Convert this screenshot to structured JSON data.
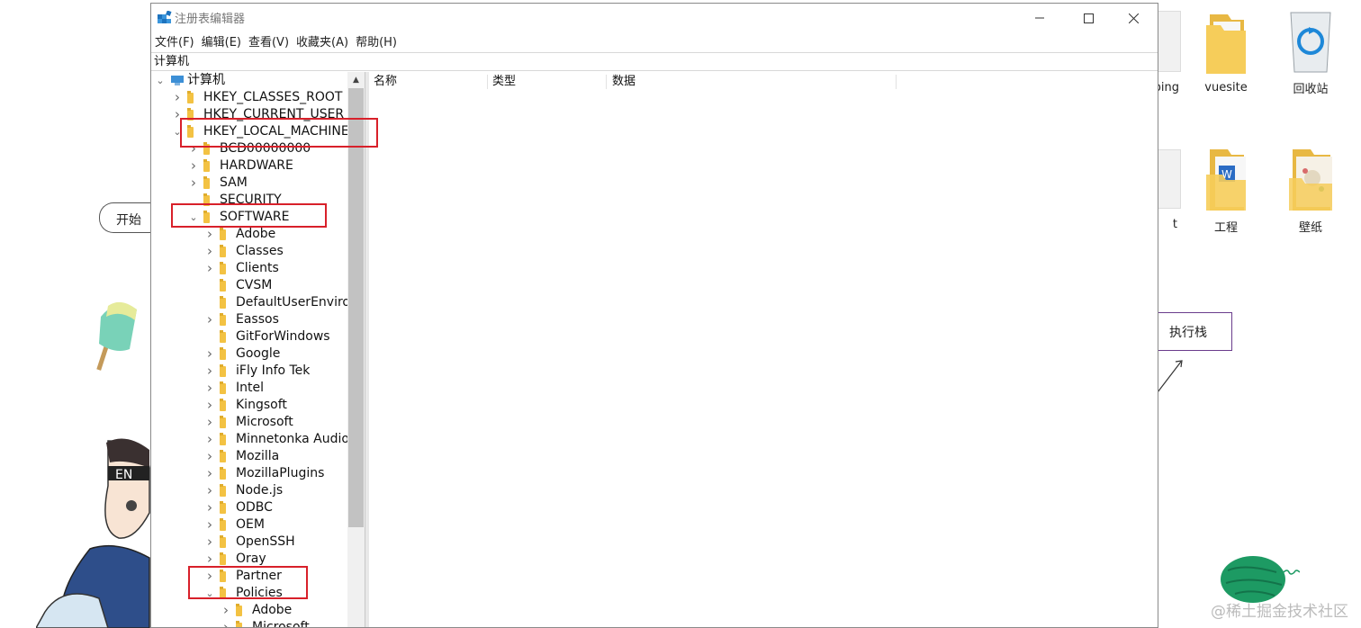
{
  "window": {
    "title": "注册表编辑器",
    "minimize_icon": "minimize-icon",
    "maximize_icon": "maximize-icon",
    "close_icon": "close-icon"
  },
  "menu": [
    {
      "label": "文件(F)"
    },
    {
      "label": "编辑(E)"
    },
    {
      "label": "查看(V)"
    },
    {
      "label": "收藏夹(A)"
    },
    {
      "label": "帮助(H)"
    }
  ],
  "address": "计算机",
  "tree": {
    "root": "计算机",
    "items": [
      {
        "label": "HKEY_CLASSES_ROOT",
        "state": "collapsed"
      },
      {
        "label": "HKEY_CURRENT_USER",
        "state": "collapsed"
      },
      {
        "label": "HKEY_LOCAL_MACHINE",
        "state": "expanded"
      },
      {
        "label": "BCD00000000",
        "state": "collapsed"
      },
      {
        "label": "HARDWARE",
        "state": "collapsed"
      },
      {
        "label": "SAM",
        "state": "collapsed"
      },
      {
        "label": "SECURITY",
        "state": "leaf"
      },
      {
        "label": "SOFTWARE",
        "state": "expanded"
      },
      {
        "label": "Adobe",
        "state": "collapsed"
      },
      {
        "label": "Classes",
        "state": "collapsed"
      },
      {
        "label": "Clients",
        "state": "collapsed"
      },
      {
        "label": "CVSM",
        "state": "leaf"
      },
      {
        "label": "DefaultUserEnvironn",
        "state": "leaf"
      },
      {
        "label": "Eassos",
        "state": "collapsed"
      },
      {
        "label": "GitForWindows",
        "state": "leaf"
      },
      {
        "label": "Google",
        "state": "collapsed"
      },
      {
        "label": "iFly Info Tek",
        "state": "collapsed"
      },
      {
        "label": "Intel",
        "state": "collapsed"
      },
      {
        "label": "Kingsoft",
        "state": "collapsed"
      },
      {
        "label": "Microsoft",
        "state": "collapsed"
      },
      {
        "label": "Minnetonka Audio S",
        "state": "collapsed"
      },
      {
        "label": "Mozilla",
        "state": "collapsed"
      },
      {
        "label": "MozillaPlugins",
        "state": "collapsed"
      },
      {
        "label": "Node.js",
        "state": "collapsed"
      },
      {
        "label": "ODBC",
        "state": "collapsed"
      },
      {
        "label": "OEM",
        "state": "collapsed"
      },
      {
        "label": "OpenSSH",
        "state": "collapsed"
      },
      {
        "label": "Oray",
        "state": "collapsed"
      },
      {
        "label": "Partner",
        "state": "collapsed"
      },
      {
        "label": "Policies",
        "state": "expanded"
      },
      {
        "label": "Adobe",
        "state": "collapsed"
      },
      {
        "label": "Microsoft",
        "state": "collapsed"
      }
    ]
  },
  "columns": [
    {
      "label": "名称"
    },
    {
      "label": "类型"
    },
    {
      "label": "数据"
    }
  ],
  "desktop": {
    "icons": [
      {
        "label": "ping",
        "icon": "folder-icon"
      },
      {
        "label": "vuesite",
        "icon": "folder-icon"
      },
      {
        "label": "回收站",
        "icon": "recycle-bin-icon"
      },
      {
        "label": "t",
        "icon": "folder-icon"
      },
      {
        "label": "工程",
        "icon": "word-folder-icon"
      },
      {
        "label": "壁纸",
        "icon": "folder-icon"
      }
    ],
    "note_start": "开始",
    "note_stack": "执行栈",
    "watermark": "@稀土掘金技术社区"
  },
  "colors": {
    "highlight": "#d8202a",
    "folder": "#f3c243"
  }
}
